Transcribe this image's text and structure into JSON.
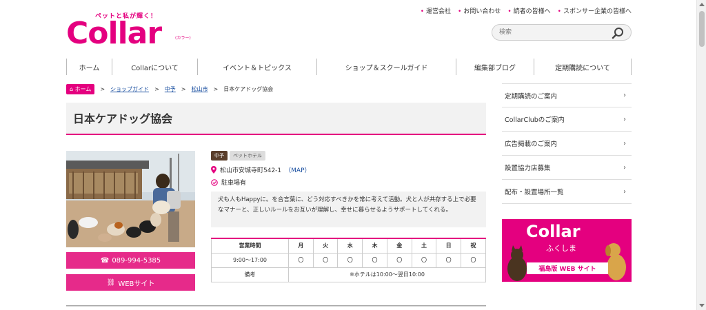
{
  "header": {
    "tagline": "ペットと私が輝く！",
    "logo_text": "Collar",
    "logo_kana": "(カラー)",
    "top_links": [
      "運営会社",
      "お問い合わせ",
      "読者の皆様へ",
      "スポンサー企業の皆様へ"
    ],
    "search_placeholder": "検索"
  },
  "nav": {
    "items": [
      "ホーム",
      "Collarについて",
      "イベント＆トピックス",
      "ショップ＆スクールガイド",
      "編集部ブログ",
      "定期購読について"
    ]
  },
  "breadcrumb": {
    "home": "ホーム",
    "sep": ">",
    "items": [
      "ショップガイド",
      "中予",
      "松山市"
    ],
    "current": "日本ケアドッグ協会"
  },
  "page": {
    "title": "日本ケアドッグ協会",
    "tags": [
      "中予",
      "ペットホテル"
    ],
    "address": "松山市安城寺町542-1",
    "map_link": "（MAP）",
    "parking": "駐車場有",
    "description": "犬も人もHappyに。を合言葉に、どう対応すべきかを常に考えて活動。犬と人が共存する上で必要なマナーと、正しいルールをお互いが理解し、幸せに暮らせるようサポートしてくれる。",
    "phone": "089-994-5385",
    "web_label": "WEBサイト"
  },
  "hours_table": {
    "header_label": "営業時間",
    "days": [
      "月",
      "火",
      "水",
      "木",
      "金",
      "土",
      "日",
      "祝"
    ],
    "time": "9:00～17:00",
    "marks": [
      "〇",
      "〇",
      "〇",
      "〇",
      "〇",
      "〇",
      "〇",
      "〇"
    ],
    "note_label": "備考",
    "note": "※ホテルは10:00～翌日10:00"
  },
  "sidebar": {
    "items": [
      "定期購読のご案内",
      "CollarClubのご案内",
      "広告掲載のご案内",
      "設置協力店募集",
      "配布・設置場所一覧"
    ],
    "arrow": "›"
  },
  "banner": {
    "title": "Collar",
    "subtitle": "ふくしま",
    "cta": "福島版 WEB サイト"
  },
  "colors": {
    "accent": "#e4007f",
    "link": "#1a4fa0"
  }
}
